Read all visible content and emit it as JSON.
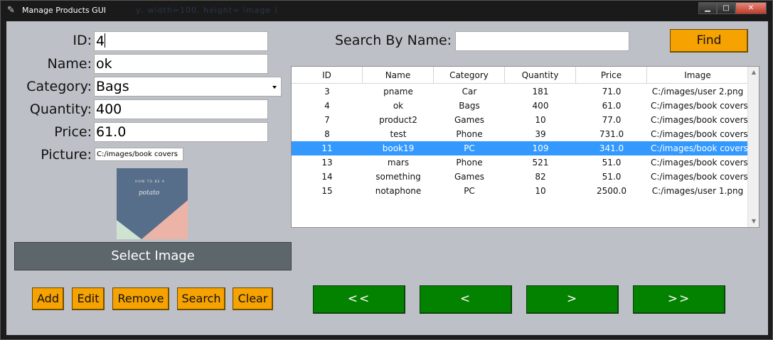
{
  "window": {
    "title": "Manage Products GUI",
    "ghost_text": "y, width=100, height= image )",
    "buttons": {
      "minimize": "▁",
      "maximize": "□",
      "close": "✕"
    }
  },
  "form": {
    "id_label": "ID:",
    "id_value": "4",
    "name_label": "Name:",
    "name_value": "ok",
    "category_label": "Category:",
    "category_value": "Bags",
    "quantity_label": "Quantity:",
    "quantity_value": "400",
    "price_label": "Price:",
    "price_value": "61.0",
    "picture_label": "Picture:",
    "picture_value": "C:/images/book covers",
    "select_image_label": "Select Image"
  },
  "book_cover": {
    "line1": "HOW TO BE A",
    "line2": "potato"
  },
  "actions": {
    "add": "Add",
    "edit": "Edit",
    "remove": "Remove",
    "search": "Search",
    "clear": "Clear"
  },
  "nav": {
    "first": "<<",
    "prev": "<",
    "next": ">",
    "last": ">>"
  },
  "search": {
    "label": "Search By Name:",
    "value": "",
    "find": "Find"
  },
  "table": {
    "columns": [
      "ID",
      "Name",
      "Category",
      "Quantity",
      "Price",
      "Image"
    ],
    "rows": [
      [
        "3",
        "pname",
        "Car",
        "181",
        "71.0",
        "C:/images/user 2.png"
      ],
      [
        "4",
        "ok",
        "Bags",
        "400",
        "61.0",
        "C:/images/book covers u"
      ],
      [
        "7",
        "product2",
        "Games",
        "10",
        "77.0",
        "C:/images/book covers u"
      ],
      [
        "8",
        "test",
        "Phone",
        "39",
        "731.0",
        "C:/images/book covers u"
      ],
      [
        "11",
        "book19",
        "PC",
        "109",
        "341.0",
        "C:/images/book covers u"
      ],
      [
        "13",
        "mars",
        "Phone",
        "521",
        "51.0",
        "C:/images/book covers u"
      ],
      [
        "14",
        "something",
        "Games",
        "82",
        "51.0",
        "C:/images/book covers u"
      ],
      [
        "15",
        "notaphone",
        "PC",
        "10",
        "2500.0",
        "C:/images/user 1.png"
      ]
    ],
    "selected_index": 4
  },
  "colors": {
    "background": "#bdc1c7",
    "orange_button": "#f6a200",
    "green_button": "#038200",
    "select_image_button": "#5c666b",
    "selection": "#3399ff"
  },
  "icons": {
    "title_icon": "feather-icon",
    "combo_arrow": "dropdown-arrow-icon",
    "scroll_up": "scroll-up-arrow-icon",
    "scroll_down": "scroll-down-arrow-icon"
  }
}
